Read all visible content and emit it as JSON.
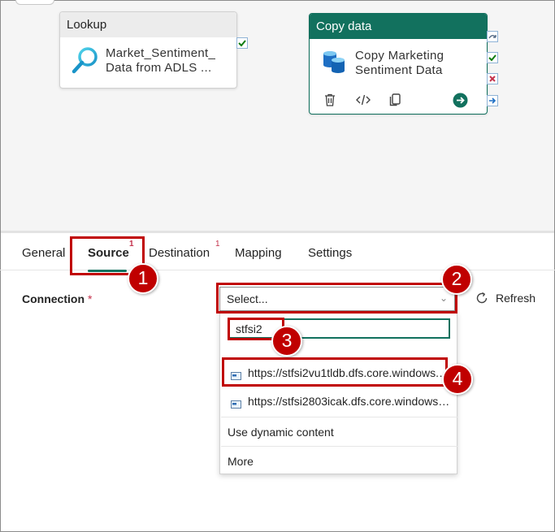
{
  "pipeline": {
    "lookup": {
      "title": "Lookup",
      "name_line1": "Market_Sentiment_",
      "name_line2": "Data  from  ADLS  ...",
      "icon": "magnifier-icon"
    },
    "copy_data": {
      "title": "Copy data",
      "name_line1": "Copy Marketing",
      "name_line2": "Sentiment Data",
      "icon": "database-icon",
      "tools": [
        "delete-icon",
        "code-icon",
        "copy-icon",
        "run-arrow-icon"
      ]
    }
  },
  "tabs": [
    {
      "label": "General",
      "badge": ""
    },
    {
      "label": "Source",
      "badge": "1"
    },
    {
      "label": "Destination",
      "badge": "1"
    },
    {
      "label": "Mapping",
      "badge": ""
    },
    {
      "label": "Settings",
      "badge": ""
    }
  ],
  "connection": {
    "label": "Connection",
    "required_mark": "*",
    "select_placeholder": "Select...",
    "refresh_label": "Refresh"
  },
  "dropdown": {
    "search_value": "stfsi2",
    "options": [
      "https://stfsi2vu1tldb.dfs.core.windows.net",
      "https://stfsi2803icak.dfs.core.windows.net"
    ],
    "dynamic_content": "Use dynamic content",
    "more": "More"
  },
  "callouts": [
    "1",
    "2",
    "3",
    "4"
  ],
  "colors": {
    "accent": "#12715e",
    "callout": "#c00000",
    "required": "#c4314b"
  }
}
